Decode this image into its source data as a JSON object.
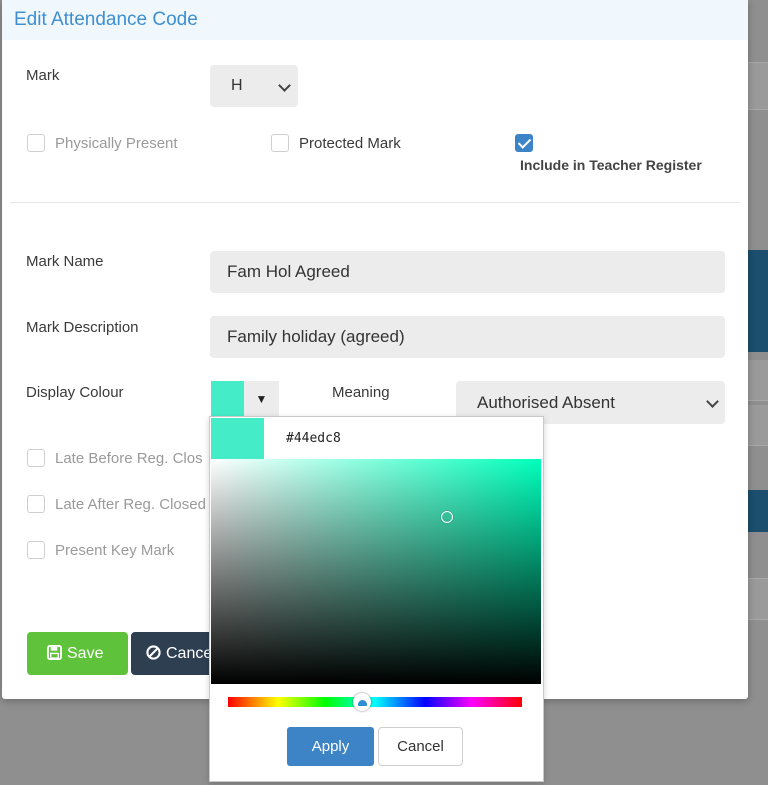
{
  "modal": {
    "title": "Edit Attendance Code"
  },
  "mark": {
    "label": "Mark",
    "value": "H"
  },
  "checkboxes_top": [
    {
      "label": "Physically Present",
      "checked": false,
      "disabled": true
    },
    {
      "label": "Protected Mark",
      "checked": false,
      "disabled": false
    },
    {
      "label": "Include in Teacher Register",
      "checked": true,
      "disabled": false
    }
  ],
  "mark_name": {
    "label": "Mark Name",
    "value": "Fam Hol Agreed"
  },
  "mark_description": {
    "label": "Mark Description",
    "value": "Family holiday (agreed)"
  },
  "display_colour": {
    "label": "Display Colour",
    "value": "#44edc8"
  },
  "meaning": {
    "label": "Meaning",
    "value": "Authorised Absent"
  },
  "checkboxes_bottom": [
    {
      "label": "Late Before Reg. Clos",
      "checked": false
    },
    {
      "label": "Late After Reg. Closed",
      "checked": false
    },
    {
      "label": "Present Key Mark",
      "checked": false
    }
  ],
  "buttons": {
    "save": "Save",
    "cancel": "Cance"
  },
  "colour_picker": {
    "hex": "#44edc8",
    "apply": "Apply",
    "cancel": "Cancel",
    "hue_fraction": 0.46
  },
  "colors": {
    "accent": "#3d84c6",
    "title": "#3f8fcf",
    "save": "#5fc23b",
    "cancel_dark": "#2e3f52",
    "swatch": "#44edc8"
  }
}
